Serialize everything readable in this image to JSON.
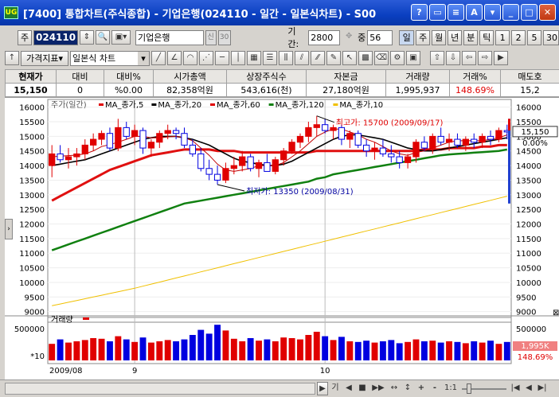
{
  "window": {
    "app_icon": "UG",
    "title": "[7400] 통합차트(주식종합) - 기업은행(024110 - 일간 - 일본식차트) - S00",
    "buttons": [
      "?",
      "▭",
      "≡",
      "A",
      "▾",
      "_",
      "□",
      "✕"
    ]
  },
  "toolbar1": {
    "type_label": "주",
    "code": "024110",
    "name": "기업은행",
    "credit": "신",
    "credit_rate": "30",
    "period_label": "기간:",
    "period_value": "2800",
    "count_label": "중",
    "count_value": "56",
    "intervals": [
      "일",
      "주",
      "월",
      "년",
      "분",
      "틱"
    ],
    "minutes": [
      "1",
      "2",
      "5",
      "30"
    ]
  },
  "toolbar2": {
    "indicator_label": "가격지표",
    "chart_type": "일본식 차트"
  },
  "quote": {
    "headers": [
      "현재가",
      "대비",
      "대비%",
      "시가총액",
      "상장주식수",
      "자본금",
      "거래량",
      "거래%",
      "매도호"
    ],
    "values": [
      "15,150",
      "0",
      "%0.00",
      "82,358억원",
      "543,616(천)",
      "27,180억원",
      "1,995,937",
      "148.69%",
      "15,2"
    ]
  },
  "chart": {
    "legend_price": "주가(일간)",
    "legend_items": [
      {
        "label": "MA_종가,5",
        "color": "#e00000"
      },
      {
        "label": "MA_종가,20",
        "color": "#000000"
      },
      {
        "label": "MA_종가,60",
        "color": "#e00000"
      },
      {
        "label": "MA_종가,120",
        "color": "#108010"
      },
      {
        "label": "MA_종가,10",
        "color": "#f0c000"
      }
    ],
    "high_annotation": "최고가: 15700 (2009/09/17)",
    "low_annotation": "최저가: 13350 (2009/08/31)",
    "current_price": "15,150",
    "current_pct": "0.00%",
    "y_ticks": [
      "16000",
      "15500",
      "15000",
      "14500",
      "14000",
      "13500",
      "13000",
      "12500",
      "12000",
      "11500",
      "11000",
      "10500",
      "10000",
      "9500",
      "9000"
    ],
    "right_ticks": [
      "16000",
      "15500",
      "15000",
      "14500",
      "14000",
      "13500",
      "13000",
      "12500",
      "12000",
      "11500",
      "11000",
      "10500",
      "10000",
      "9500",
      "9000"
    ],
    "volume_label": "거래량",
    "volume_tick": "500000",
    "volume_unit": "*10",
    "volume_current": "1,995K",
    "volume_pct": "148.69%",
    "x_labels": [
      "2009/08",
      "9",
      "10"
    ],
    "colors": {
      "up": "#e00000",
      "down": "#0000e0",
      "ma5": "#c00000",
      "ma20": "#000000",
      "ma60": "#e01010",
      "ma120": "#108010",
      "ma_long": "#f0c000"
    }
  },
  "chart_data": {
    "type": "candlestick",
    "ylim": [
      8800,
      16100
    ],
    "volume_ylim": [
      0,
      600000
    ],
    "ohlc": [
      [
        14000,
        14700,
        13600,
        14400
      ],
      [
        14400,
        14700,
        14100,
        14200
      ],
      [
        14200,
        14600,
        13900,
        14300
      ],
      [
        14300,
        14600,
        14000,
        14400
      ],
      [
        14400,
        14900,
        14200,
        14700
      ],
      [
        14700,
        15100,
        14500,
        14900
      ],
      [
        14900,
        15200,
        14700,
        15100
      ],
      [
        15100,
        15300,
        14500,
        14600
      ],
      [
        14600,
        15600,
        14500,
        15300
      ],
      [
        15300,
        15500,
        14900,
        15000
      ],
      [
        15000,
        15400,
        14700,
        15200
      ],
      [
        15200,
        15300,
        14400,
        14600
      ],
      [
        14600,
        14900,
        14300,
        14800
      ],
      [
        14800,
        15200,
        14600,
        15100
      ],
      [
        15100,
        15400,
        14900,
        15200
      ],
      [
        15200,
        15300,
        14900,
        15100
      ],
      [
        15100,
        15300,
        14600,
        14700
      ],
      [
        14700,
        14900,
        14300,
        14400
      ],
      [
        14400,
        14600,
        13800,
        13900
      ],
      [
        13900,
        14200,
        13500,
        13700
      ],
      [
        13700,
        14000,
        13350,
        13500
      ],
      [
        13500,
        14100,
        13400,
        13900
      ],
      [
        13900,
        14300,
        13700,
        14000
      ],
      [
        14000,
        14500,
        13800,
        14300
      ],
      [
        14300,
        14400,
        13800,
        13900
      ],
      [
        13900,
        14200,
        13600,
        14100
      ],
      [
        14100,
        14400,
        13900,
        13800
      ],
      [
        13800,
        14300,
        13700,
        14200
      ],
      [
        14200,
        14600,
        14000,
        14500
      ],
      [
        14500,
        14900,
        14400,
        14800
      ],
      [
        14800,
        15100,
        14600,
        15000
      ],
      [
        15000,
        15500,
        14800,
        15300
      ],
      [
        15300,
        15700,
        15000,
        15400
      ],
      [
        15400,
        15600,
        15100,
        15200
      ],
      [
        15200,
        15400,
        14900,
        15300
      ],
      [
        15300,
        15400,
        14700,
        14900
      ],
      [
        14900,
        15200,
        14600,
        15100
      ],
      [
        15100,
        15200,
        14600,
        14700
      ],
      [
        14700,
        14900,
        14300,
        14500
      ],
      [
        14500,
        14800,
        14200,
        14600
      ],
      [
        14600,
        14900,
        14300,
        14400
      ],
      [
        14400,
        14700,
        14100,
        14300
      ],
      [
        14300,
        14500,
        13900,
        14100
      ],
      [
        14100,
        14400,
        13900,
        14300
      ],
      [
        14300,
        14900,
        14100,
        14800
      ],
      [
        14800,
        15000,
        14500,
        14600
      ],
      [
        14600,
        15100,
        14400,
        15000
      ],
      [
        15000,
        15300,
        14700,
        14800
      ],
      [
        14800,
        15100,
        14500,
        14900
      ],
      [
        14900,
        15100,
        14600,
        14700
      ],
      [
        14700,
        15000,
        14500,
        14900
      ],
      [
        14900,
        15100,
        14600,
        14800
      ],
      [
        14800,
        15100,
        14600,
        15000
      ],
      [
        15000,
        15200,
        14700,
        14900
      ],
      [
        14900,
        15300,
        14800,
        15200
      ],
      [
        15200,
        15400,
        14900,
        15150
      ]
    ],
    "volume": [
      260000,
      330000,
      280000,
      300000,
      320000,
      350000,
      340000,
      300000,
      380000,
      330000,
      290000,
      360000,
      280000,
      300000,
      320000,
      300000,
      330000,
      400000,
      480000,
      420000,
      560000,
      470000,
      340000,
      300000,
      350000,
      310000,
      330000,
      300000,
      360000,
      350000,
      330000,
      400000,
      450000,
      380000,
      320000,
      370000,
      300000,
      290000,
      310000,
      280000,
      300000,
      320000,
      270000,
      290000,
      330000,
      300000,
      310000,
      280000,
      300000,
      290000,
      270000,
      300000,
      280000,
      310000,
      260000,
      290000
    ],
    "ma5": [
      14300,
      14320,
      14340,
      14360,
      14400,
      14500,
      14650,
      14720,
      14800,
      14900,
      15000,
      15000,
      14950,
      14950,
      14980,
      15000,
      14950,
      14850,
      14600,
      14350,
      14050,
      13850,
      13800,
      13850,
      13900,
      14000,
      14000,
      14000,
      14100,
      14300,
      14500,
      14750,
      15000,
      15150,
      15250,
      15250,
      15150,
      15050,
      14900,
      14800,
      14650,
      14500,
      14400,
      14350,
      14450,
      14500,
      14600,
      14700,
      14800,
      14850,
      14850,
      14850,
      14850,
      14900,
      14950,
      15050
    ],
    "ma20": [
      14000,
      14050,
      14100,
      14150,
      14200,
      14300,
      14400,
      14500,
      14600,
      14700,
      14800,
      14900,
      14950,
      15000,
      15000,
      15000,
      14950,
      14900,
      14800,
      14700,
      14550,
      14400,
      14250,
      14150,
      14100,
      14050,
      14000,
      14000,
      14050,
      14150,
      14300,
      14450,
      14600,
      14750,
      14900,
      15000,
      15050,
      15050,
      15000,
      14950,
      14900,
      14800,
      14700,
      14600,
      14550,
      14500,
      14500,
      14550,
      14600,
      14650,
      14700,
      14750,
      14800,
      14850,
      14900,
      14950
    ],
    "ma60": [
      12800,
      12950,
      13100,
      13250,
      13400,
      13550,
      13700,
      13850,
      13950,
      14050,
      14150,
      14250,
      14350,
      14400,
      14450,
      14500,
      14550,
      14550,
      14550,
      14550,
      14500,
      14500,
      14500,
      14450,
      14450,
      14450,
      14450,
      14450,
      14450,
      14450,
      14450,
      14450,
      14500,
      14500,
      14500,
      14500,
      14500,
      14500,
      14500,
      14500,
      14500,
      14500,
      14500,
      14500,
      14500,
      14550,
      14550,
      14550,
      14600,
      14600,
      14600,
      14600,
      14650,
      14650,
      14700,
      14700
    ],
    "ma120": [
      11100,
      11200,
      11300,
      11400,
      11500,
      11600,
      11700,
      11800,
      11900,
      12000,
      12100,
      12200,
      12300,
      12400,
      12500,
      12600,
      12700,
      12750,
      12800,
      12850,
      12900,
      12950,
      13000,
      13050,
      13100,
      13150,
      13200,
      13250,
      13300,
      13350,
      13400,
      13450,
      13550,
      13600,
      13700,
      13750,
      13800,
      13850,
      13900,
      13950,
      14000,
      14050,
      14100,
      14150,
      14200,
      14250,
      14300,
      14350,
      14380,
      14400,
      14420,
      14440,
      14460,
      14480,
      14500,
      14550
    ],
    "ma_long": [
      9200,
      9260,
      9320,
      9380,
      9440,
      9500,
      9560,
      9620,
      9680,
      9740,
      9800,
      9870,
      9940,
      10010,
      10080,
      10150,
      10220,
      10290,
      10360,
      10430,
      10500,
      10570,
      10640,
      10710,
      10780,
      10850,
      10920,
      10990,
      11060,
      11130,
      11200,
      11270,
      11340,
      11410,
      11480,
      11550,
      11620,
      11690,
      11760,
      11830,
      11900,
      11970,
      12040,
      12110,
      12180,
      12250,
      12320,
      12390,
      12460,
      12530,
      12600,
      12670,
      12740,
      12810,
      12880,
      12950
    ]
  },
  "bottom": {
    "nav_labels": [
      "◀",
      "▶",
      "기",
      "◀",
      "■",
      "▶▶",
      "↔",
      "↕",
      "+",
      "-",
      "1:1",
      "|◀",
      "◀",
      "▶|"
    ]
  }
}
